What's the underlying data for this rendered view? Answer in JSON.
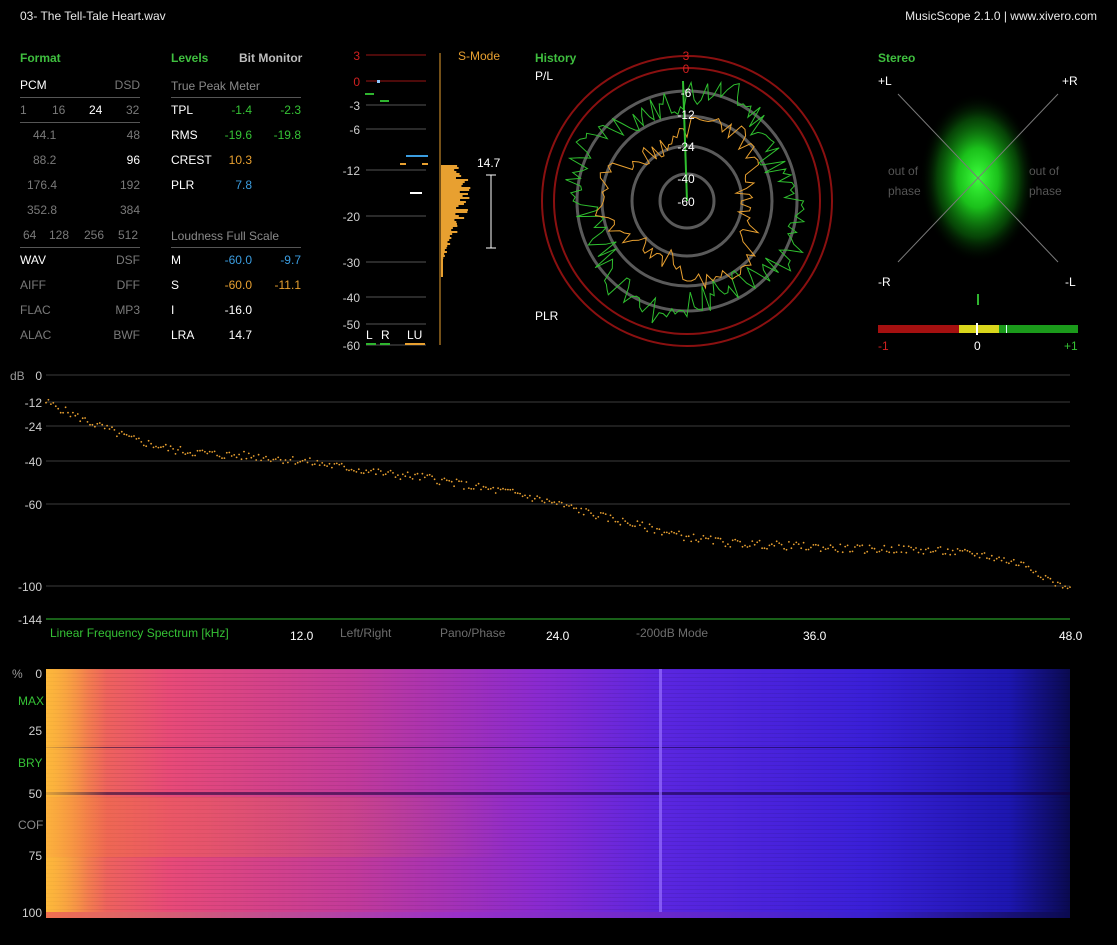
{
  "header": {
    "file": "03- The Tell-Tale Heart.wav",
    "app": "MusicScope 2.1.0 | www.xivero.com"
  },
  "format": {
    "title": "Format",
    "pcm": "PCM",
    "dsd": "DSD",
    "bits": [
      "1",
      "16",
      "24",
      "32"
    ],
    "rates": [
      {
        "a": "44.1",
        "b": "48"
      },
      {
        "a": "88.2",
        "b": "96"
      },
      {
        "a": "176.4",
        "b": "192"
      },
      {
        "a": "352.8",
        "b": "384"
      }
    ],
    "dsd_rates": [
      "64",
      "128",
      "256",
      "512"
    ],
    "types": [
      {
        "a": "WAV",
        "b": "DSF"
      },
      {
        "a": "AIFF",
        "b": "DFF"
      },
      {
        "a": "FLAC",
        "b": "MP3"
      },
      {
        "a": "ALAC",
        "b": "BWF"
      }
    ]
  },
  "levels": {
    "title": "Levels",
    "bit_monitor": "Bit Monitor",
    "true_peak_label": "True Peak Meter",
    "rows": [
      {
        "label": "TPL",
        "l": "-1.4",
        "r": "-2.3"
      },
      {
        "label": "RMS",
        "l": "-19.6",
        "r": "-19.8"
      },
      {
        "label": "CREST",
        "l": "10.3"
      },
      {
        "label": "PLR",
        "l": "7.8"
      }
    ],
    "loudness_label": "Loudness Full Scale",
    "loud_rows": [
      {
        "label": "M",
        "l": "-60.0",
        "r": "-9.7"
      },
      {
        "label": "S",
        "l": "-60.0",
        "r": "-11.1"
      },
      {
        "label": "I",
        "l": "-16.0"
      },
      {
        "label": "LRA",
        "l": "14.7"
      }
    ]
  },
  "meter": {
    "scale": [
      "3",
      "0",
      "-3",
      "-6",
      "-12",
      "-20",
      "-30",
      "-40",
      "-50",
      "-60"
    ],
    "mode": "S-Mode",
    "value": "14.7",
    "channels": [
      "L",
      "R",
      "LU"
    ]
  },
  "history": {
    "title": "History",
    "top_label": "P/L",
    "bottom_label": "PLR",
    "rings": [
      "3",
      "0",
      "-6",
      "-12",
      "-24",
      "-40",
      "-60"
    ]
  },
  "stereo": {
    "title": "Stereo",
    "corners": {
      "tl": "+L",
      "tr": "+R",
      "bl": "-R",
      "br": "-L"
    },
    "out_of_phase": [
      "out of",
      "phase"
    ],
    "corr_labels": [
      "-1",
      "0",
      "+1"
    ]
  },
  "spectrum": {
    "db_label": "dB",
    "y_ticks": [
      "0",
      "-12",
      "-24",
      "-40",
      "-60",
      "-100",
      "-144"
    ],
    "x_title": "Linear Frequency Spectrum [kHz]",
    "x_ticks": [
      "12.0",
      "24.0",
      "36.0",
      "48.0"
    ],
    "modes": [
      "Left/Right",
      "Pano/Phase",
      "-200dB Mode"
    ]
  },
  "spectrogram": {
    "y_labels": [
      "%",
      "0",
      "MAX",
      "25",
      "BRY",
      "50",
      "COF",
      "75",
      "100"
    ]
  },
  "chart_data": {
    "type": "line",
    "xlabel": "Linear Frequency Spectrum [kHz]",
    "ylabel": "dB",
    "xlim": [
      0,
      48
    ],
    "x": [
      0,
      2,
      4,
      6,
      8,
      10,
      12,
      14,
      16,
      18,
      20,
      22,
      24,
      26,
      28,
      30,
      32,
      34,
      36,
      38,
      40,
      42,
      44,
      46,
      48
    ],
    "values": [
      -12,
      -22,
      -30,
      -35,
      -37,
      -38,
      -40,
      -43,
      -46,
      -48,
      -52,
      -55,
      -60,
      -66,
      -71,
      -76,
      -79,
      -80,
      -81,
      -82,
      -82,
      -83,
      -85,
      -90,
      -103
    ]
  },
  "colors": {
    "accent": "#35c235",
    "orange": "#e8a030",
    "red": "#b01010",
    "blue": "#3b9de0"
  }
}
